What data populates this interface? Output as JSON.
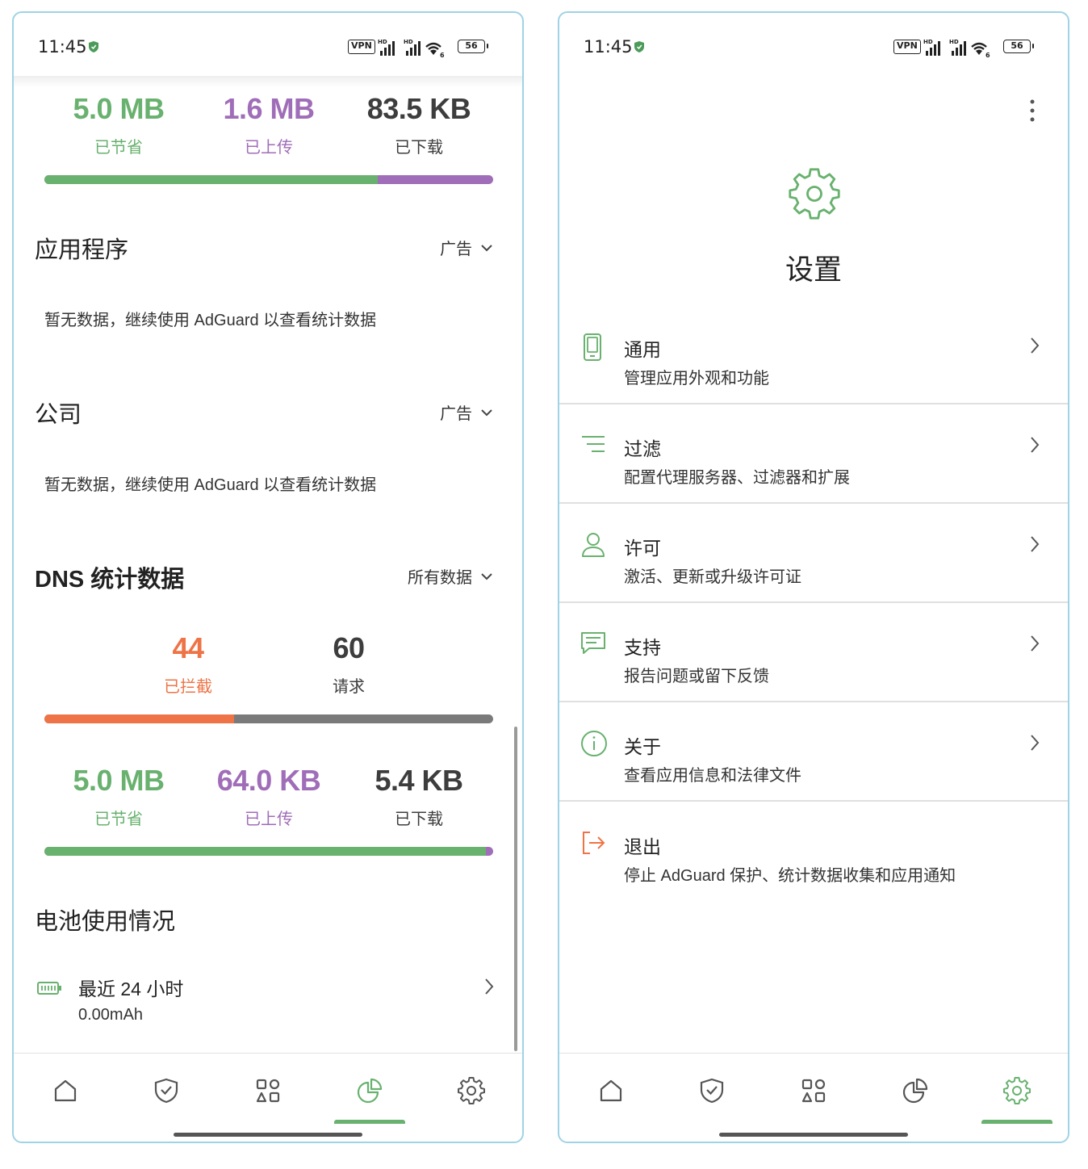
{
  "status_bar": {
    "time": "11:45",
    "vpn_label": "VPN",
    "battery_level": "56",
    "signal_label": "HD"
  },
  "colors": {
    "accent_green": "#68b16e",
    "upload_purple": "#a06db8",
    "blocked_orange": "#ee7346",
    "requests_gray": "#7a7a7a"
  },
  "left_screen": {
    "traffic_top": {
      "saved": {
        "value": "5.0 MB",
        "label": "已节省"
      },
      "uploaded": {
        "value": "1.6 MB",
        "label": "已上传"
      },
      "downloaded": {
        "value": "83.5 KB",
        "label": "已下载"
      },
      "saved_fraction": 0.742
    },
    "apps_section": {
      "title": "应用程序",
      "filter": "广告",
      "empty_text": "暂无数据，继续使用 AdGuard 以查看统计数据"
    },
    "companies_section": {
      "title": "公司",
      "filter": "广告",
      "empty_text": "暂无数据，继续使用 AdGuard 以查看统计数据"
    },
    "dns_section": {
      "title": "DNS 统计数据",
      "filter": "所有数据",
      "blocked": {
        "value": "44",
        "label": "已拦截"
      },
      "requests": {
        "value": "60",
        "label": "请求"
      },
      "blocked_fraction": 0.423
    },
    "traffic_dns": {
      "saved": {
        "value": "5.0 MB",
        "label": "已节省"
      },
      "uploaded": {
        "value": "64.0 KB",
        "label": "已上传"
      },
      "downloaded": {
        "value": "5.4 KB",
        "label": "已下载"
      },
      "saved_fraction": 0.983
    },
    "battery_section": {
      "title": "电池使用情况",
      "row_title": "最近 24 小时",
      "row_value": "0.00mAh"
    },
    "bottom_nav_active": "statistics"
  },
  "right_screen": {
    "title": "设置",
    "menu": [
      {
        "id": "general",
        "title": "通用",
        "subtitle": "管理应用外观和功能",
        "icon": "phone-icon"
      },
      {
        "id": "filtering",
        "title": "过滤",
        "subtitle": "配置代理服务器、过滤器和扩展",
        "icon": "filter-lines-icon"
      },
      {
        "id": "license",
        "title": "许可",
        "subtitle": "激活、更新或升级许可证",
        "icon": "person-icon"
      },
      {
        "id": "support",
        "title": "支持",
        "subtitle": "报告问题或留下反馈",
        "icon": "chat-icon"
      },
      {
        "id": "about",
        "title": "关于",
        "subtitle": "查看应用信息和法律文件",
        "icon": "info-icon"
      },
      {
        "id": "logout",
        "title": "退出",
        "subtitle": "停止 AdGuard 保护、统计数据收集和应用通知",
        "icon": "logout-icon"
      }
    ],
    "bottom_nav_active": "settings"
  }
}
